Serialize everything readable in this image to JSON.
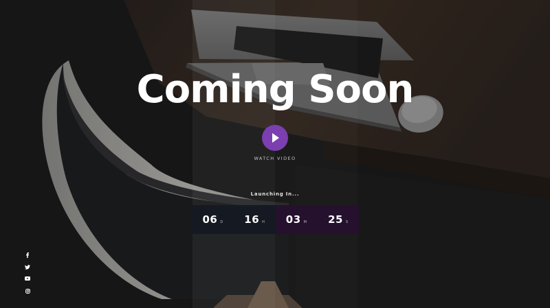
{
  "hero": {
    "title": "Coming Soon",
    "watch_label": "WATCH VIDEO",
    "launch_label": "Launching In..."
  },
  "countdown": [
    {
      "value": "06",
      "unit": "D"
    },
    {
      "value": "16",
      "unit": "H"
    },
    {
      "value": "03",
      "unit": "M"
    },
    {
      "value": "25",
      "unit": "S"
    }
  ],
  "social": [
    "facebook-icon",
    "twitter-icon",
    "youtube-icon",
    "instagram-icon"
  ],
  "colors": {
    "accent": "#7b3fb0",
    "countdown_dark": "#151922",
    "countdown_purple": "#25102e",
    "text": "#ffffff"
  }
}
